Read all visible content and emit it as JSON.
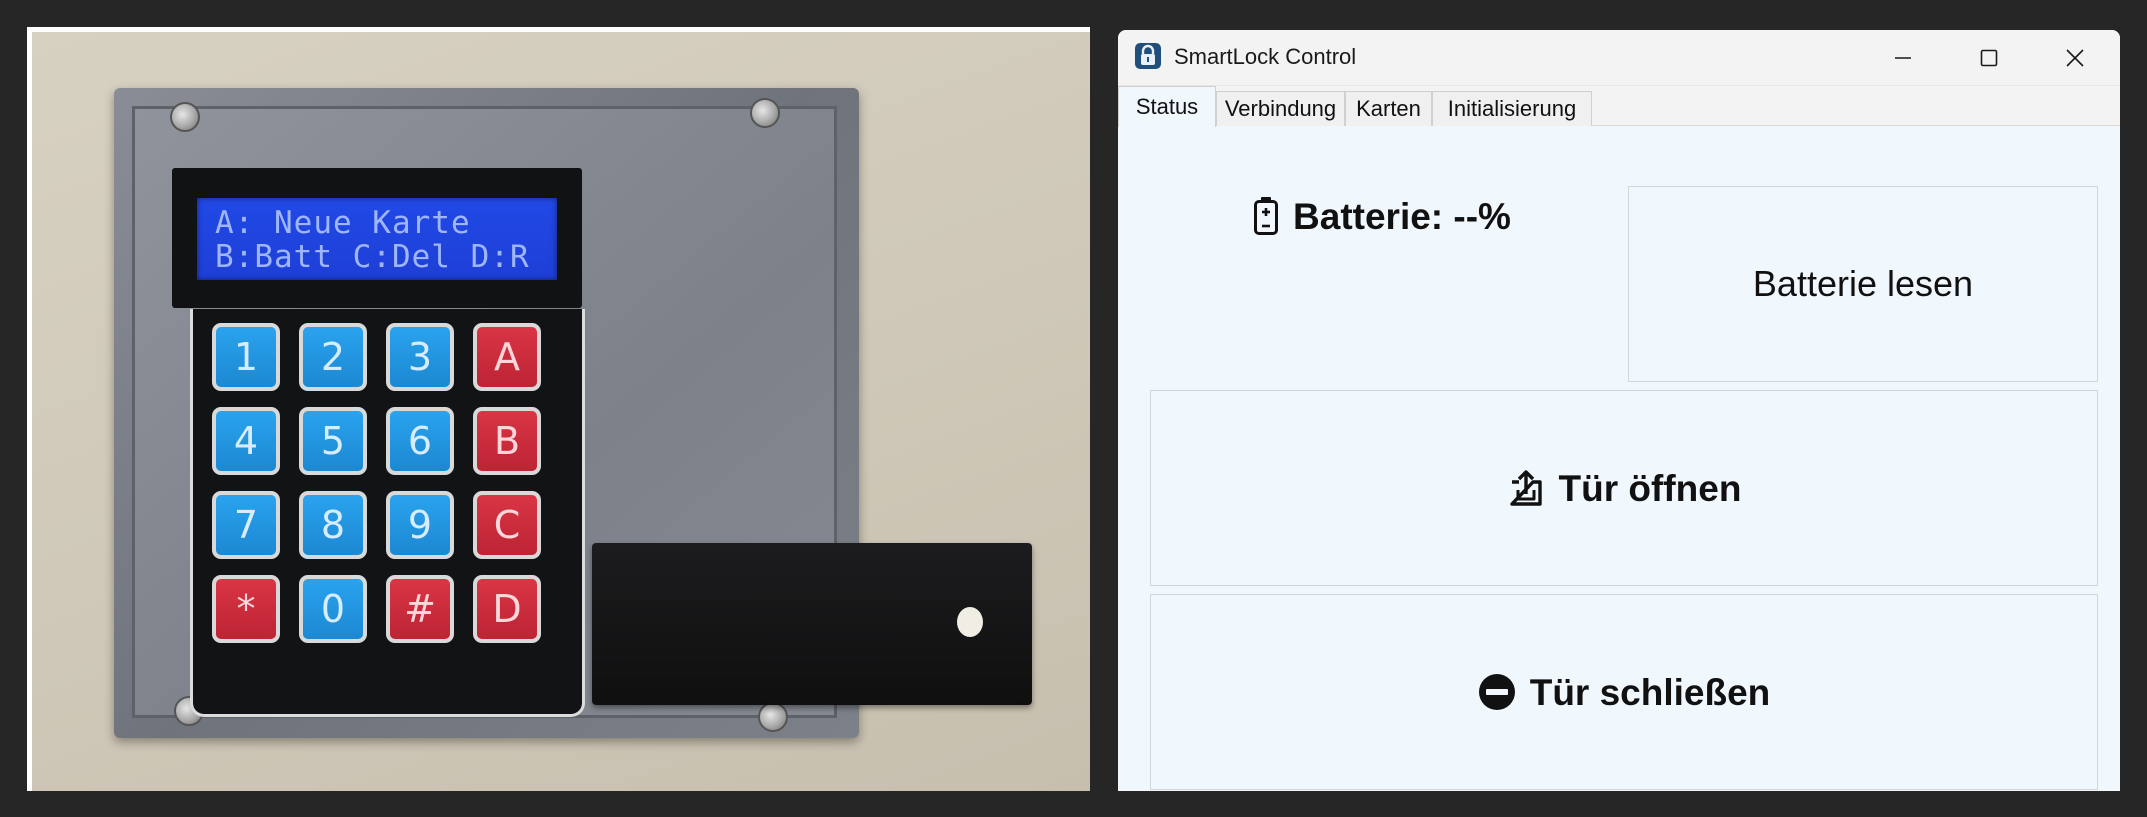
{
  "photo": {
    "lcd": {
      "line1": "A: Neue Karte",
      "line2": "B:Batt C:Del D:R"
    },
    "keypad": {
      "rows": [
        [
          "1",
          "2",
          "3",
          "A"
        ],
        [
          "4",
          "5",
          "6",
          "B"
        ],
        [
          "7",
          "8",
          "9",
          "C"
        ],
        [
          "*",
          "0",
          "#",
          "D"
        ]
      ]
    }
  },
  "window": {
    "title": "SmartLock Control",
    "icon": "lock-icon",
    "controls": [
      "minimize-icon",
      "maximize-icon",
      "close-icon"
    ]
  },
  "tabs": [
    {
      "label": "Status",
      "active": true
    },
    {
      "label": "Verbindung",
      "active": false
    },
    {
      "label": "Karten",
      "active": false
    },
    {
      "label": "Initialisierung",
      "active": false
    }
  ],
  "status": {
    "battery_label": "Batterie: --%",
    "battery_icon": "battery-icon",
    "read_battery_label": "Batterie lesen",
    "open_door_label": "Tür öffnen",
    "open_door_icon": "door-open-icon",
    "close_door_label": "Tür schließen",
    "close_door_icon": "no-entry-icon"
  },
  "colors": {
    "key_blue": "#2aa3ee",
    "key_red": "#d93545",
    "lcd_blue": "#2149e6",
    "window_bg": "#f0f7fd"
  }
}
